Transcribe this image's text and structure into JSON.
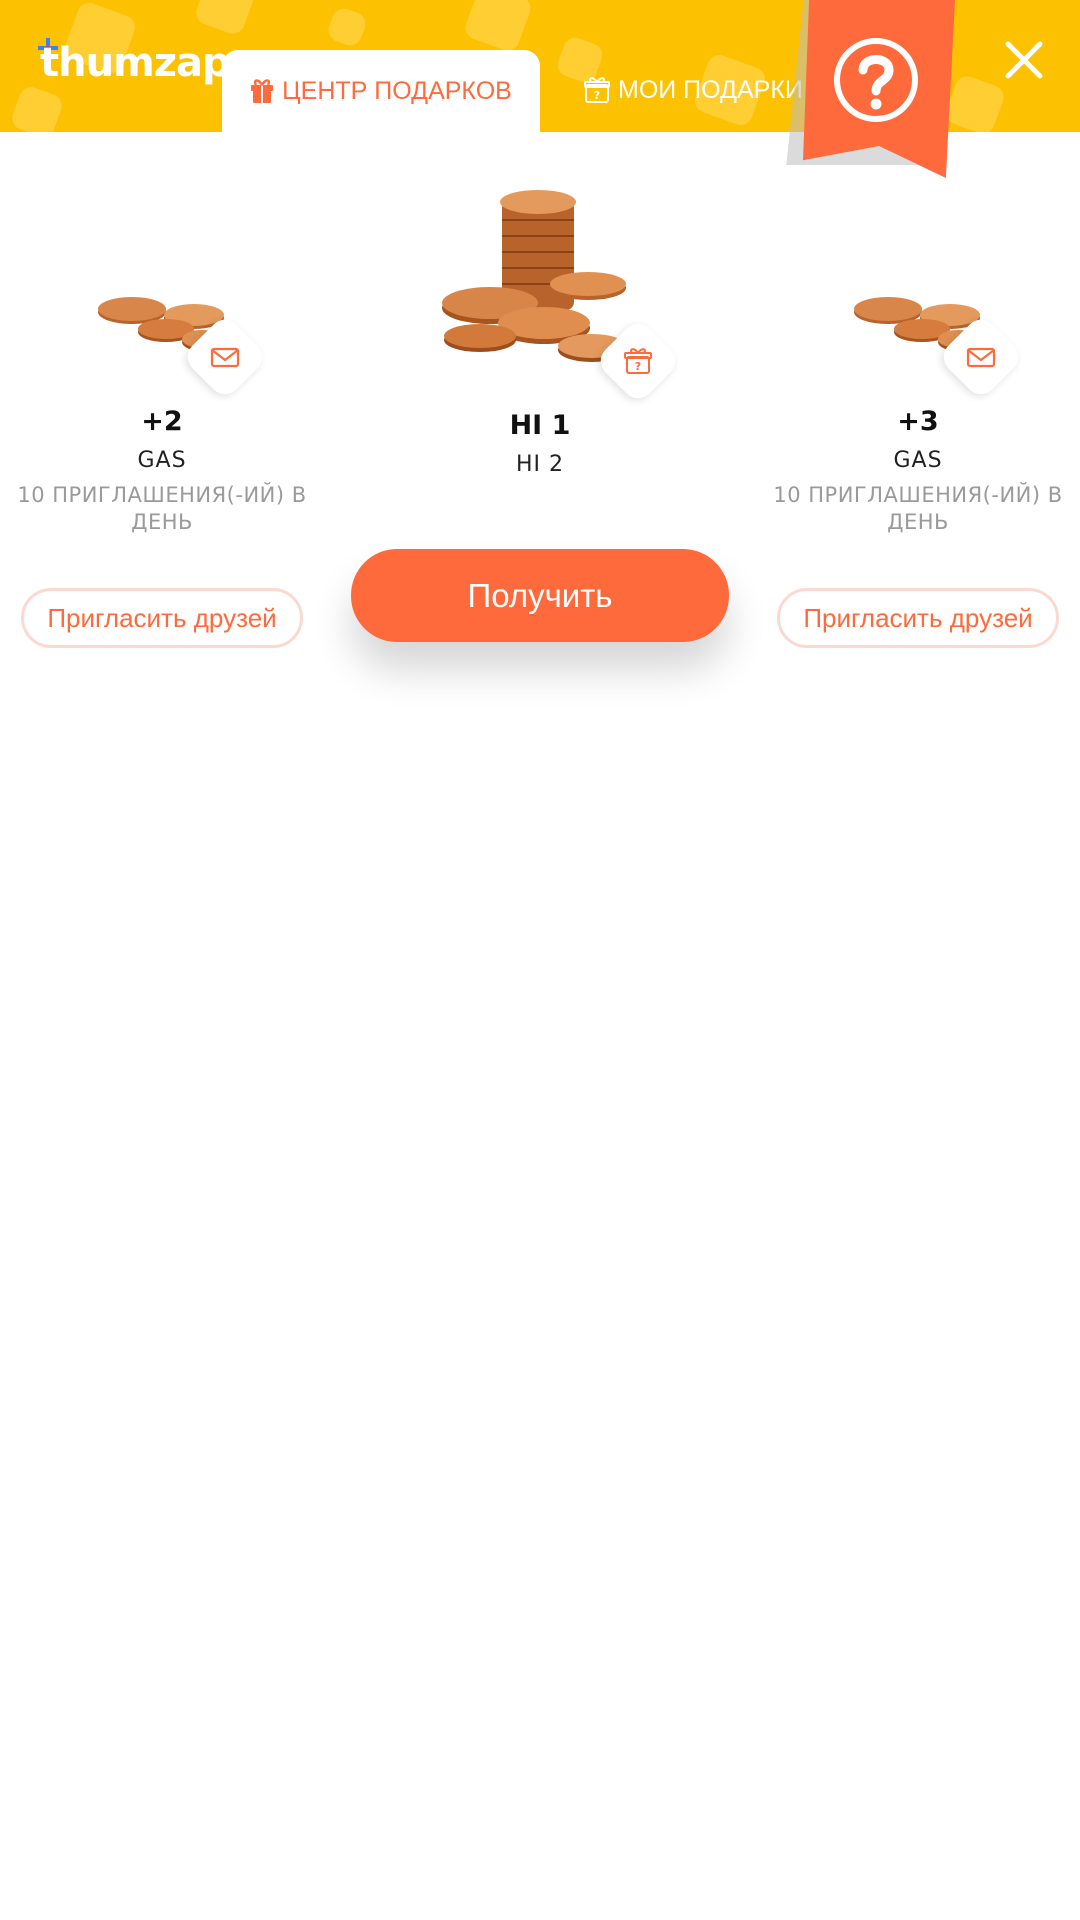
{
  "header": {
    "logo_text": "thumzap",
    "tabs": [
      {
        "label": "ЦЕНТР ПОДАРКОВ",
        "active": true
      },
      {
        "label": "МОИ ПОДАРКИ",
        "active": false
      }
    ],
    "help_icon": "question-icon",
    "close_icon": "close-icon"
  },
  "colors": {
    "header_bg": "#FCC100",
    "accent": "#FF6A3C",
    "invite_border": "#FCD9CF"
  },
  "cards": [
    {
      "amount": "+2",
      "currency": "GAS",
      "condition": "10 ПРИГЛАШЕНИЯ(-ИЙ) В ДЕНЬ",
      "badge_icon": "envelope-icon",
      "button_label": "Пригласить друзей"
    },
    {
      "amount": "HI 1",
      "currency": "HI 2",
      "badge_icon": "mystery-gift-icon",
      "button_label": "Получить"
    },
    {
      "amount": "+3",
      "currency": "GAS",
      "condition": "10 ПРИГЛАШЕНИЯ(-ИЙ) В ДЕНЬ",
      "badge_icon": "envelope-icon",
      "button_label": "Пригласить друзей"
    }
  ]
}
